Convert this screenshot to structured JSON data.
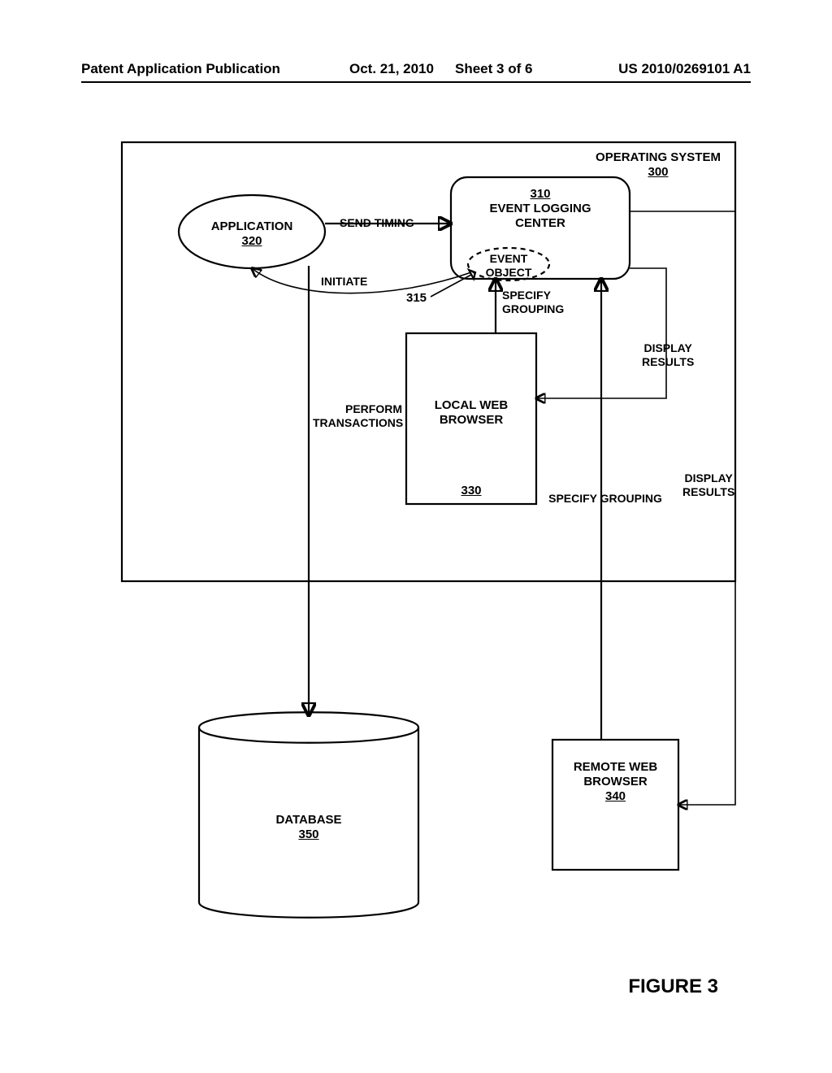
{
  "header": {
    "left": "Patent Application Publication",
    "date": "Oct. 21, 2010",
    "sheet": "Sheet 3 of 6",
    "pubno": "US 2010/0269101 A1"
  },
  "os": {
    "title": "OPERATING SYSTEM",
    "ref": "300"
  },
  "app": {
    "title": "APPLICATION",
    "ref": "320"
  },
  "elc": {
    "ref": "310",
    "title": "EVENT LOGGING\nCENTER",
    "obj": "EVENT\nOBJECT",
    "objref": "315"
  },
  "lwb": {
    "title": "LOCAL WEB\nBROWSER",
    "ref": "330"
  },
  "rwb": {
    "title": "REMOTE WEB\nBROWSER",
    "ref": "340"
  },
  "db": {
    "title": "DATABASE",
    "ref": "350"
  },
  "edges": {
    "send_timing": "SEND TIMING",
    "initiate": "INITIATE",
    "specify_grouping": "SPECIFY\nGROUPING",
    "specify_grouping2": "SPECIFY GROUPING",
    "display_results": "DISPLAY\nRESULTS",
    "display_results2": "DISPLAY\nRESULTS",
    "perform_tx": "PERFORM\nTRANSACTIONS"
  },
  "figure": "FIGURE 3"
}
